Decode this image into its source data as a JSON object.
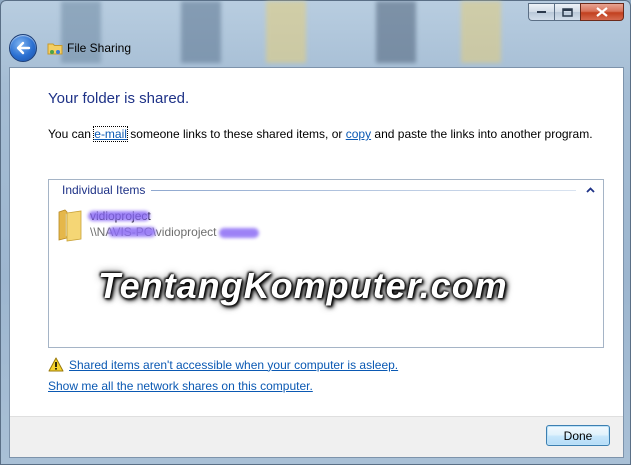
{
  "window": {
    "title": "File Sharing"
  },
  "content": {
    "heading": "Your folder is shared.",
    "description": {
      "prefix": "You can ",
      "email_link": "e-mail",
      "middle": " someone links to these shared items, or ",
      "copy_link": "copy",
      "suffix": " and paste the links into another program."
    }
  },
  "shared_items": {
    "group_title": "Individual Items",
    "items": [
      {
        "name": "vidioproject",
        "path": "\\\\NAVIS-PC\\vidioproject"
      }
    ]
  },
  "watermark": "TentangKomputer.com",
  "links": {
    "asleep_warning": "Shared items aren't accessible when your computer is asleep.",
    "show_shares": "Show me all the network shares on this computer."
  },
  "footer": {
    "done_label": "Done"
  },
  "icons": {
    "back": "back-arrow-icon",
    "app": "file-sharing-icon",
    "folder": "folder-icon",
    "warning": "warning-icon",
    "collapse": "chevron-up-icon",
    "minimize": "minimize-icon",
    "maximize": "maximize-icon",
    "close": "close-icon"
  },
  "colors": {
    "heading": "#1e3287",
    "link": "#0b59b3",
    "close_button": "#c2401f",
    "privacy_blur": "#8c6cf5"
  }
}
